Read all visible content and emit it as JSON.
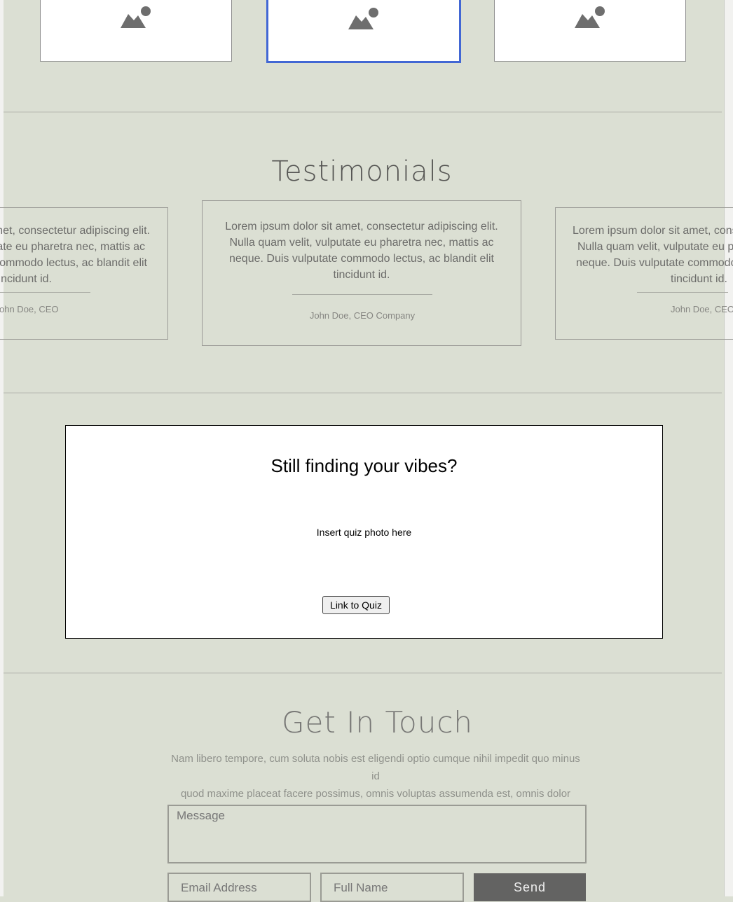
{
  "gallery": {
    "selected_index": 1
  },
  "testimonials": {
    "title": "Testimonials",
    "left": {
      "line1": "amet, consectetur adipiscing elit.",
      "line2": "utate eu pharetra nec, mattis ac",
      "line3": "commodo lectus, ac blandit elit",
      "line4": "ncidunt id.",
      "author": "ohn Doe, CEO"
    },
    "center": {
      "line1": "Lorem ipsum dolor sit amet, consectetur adipiscing elit.",
      "line2": "Nulla quam velit, vulputate eu pharetra nec, mattis ac",
      "line3": "neque. Duis vulputate commodo lectus, ac blandit elit",
      "line4": "tincidunt id.",
      "author": "John Doe, CEO Company"
    },
    "right": {
      "line1": "Lorem ipsum dolor sit amet, conse",
      "line2": "Nulla quam velit, vulputate eu ph",
      "line3": "neque. Duis vulputate commodo",
      "line4": "tincidunt id.",
      "author": "John Doe, CEO"
    }
  },
  "quiz": {
    "title": "Still finding your vibes?",
    "photo_placeholder": "Insert quiz photo here",
    "button_label": "Link to Quiz"
  },
  "contact": {
    "title": "Get In Touch",
    "subtitle_line1": "Nam libero tempore, cum soluta nobis est eligendi optio cumque nihil impedit quo minus id",
    "subtitle_line2": "quod maxime placeat facere possimus, omnis voluptas assumenda est, omnis dolor",
    "message_placeholder": "Message",
    "email_placeholder": "Email Address",
    "name_placeholder": "Full Name",
    "send_label": "Send"
  },
  "colors": {
    "background": "#dbdfd3",
    "selected_border": "#4267d4",
    "send_button": "#636362"
  }
}
